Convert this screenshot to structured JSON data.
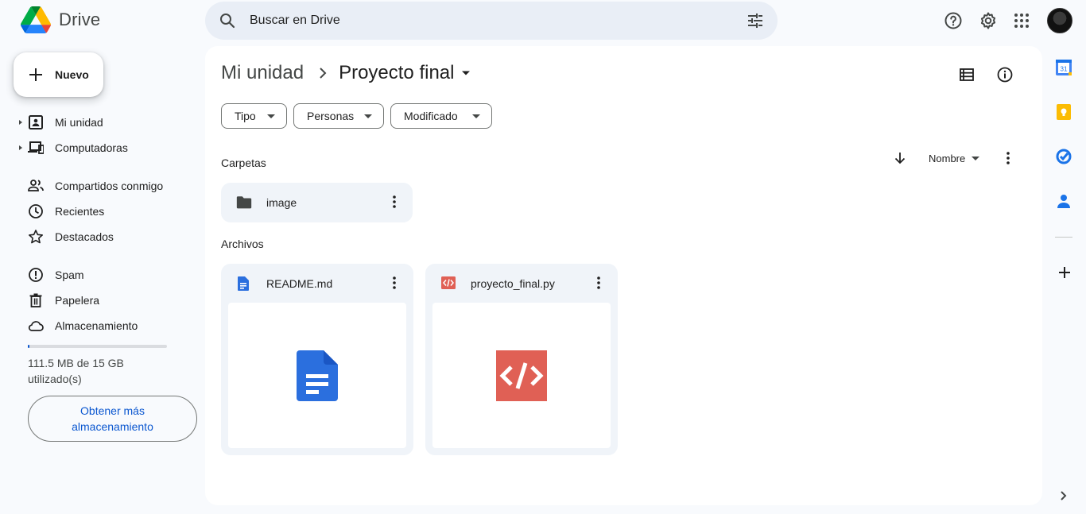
{
  "app": {
    "name": "Drive",
    "colors": {
      "accent": "#0b57d0",
      "search_bg": "#e9eef6",
      "card_bg": "#f0f4f9",
      "doc_blue": "#2b6fde",
      "code_red": "#e06055"
    }
  },
  "search": {
    "placeholder": "Buscar en Drive",
    "icon": "search-icon",
    "filter_icon": "tune-icon"
  },
  "header_icons": [
    "help-icon",
    "settings-icon",
    "apps-grid-icon",
    "avatar"
  ],
  "sidebar": {
    "new_button": "Nuevo",
    "items": [
      {
        "label": "Mi unidad",
        "icon": "my-drive-icon",
        "expandable": true
      },
      {
        "label": "Computadoras",
        "icon": "computers-icon",
        "expandable": true
      },
      {
        "label": "Compartidos conmigo",
        "icon": "shared-icon",
        "expandable": false
      },
      {
        "label": "Recientes",
        "icon": "clock-icon",
        "expandable": false
      },
      {
        "label": "Destacados",
        "icon": "star-icon",
        "expandable": false
      },
      {
        "label": "Spam",
        "icon": "spam-icon",
        "expandable": false
      },
      {
        "label": "Papelera",
        "icon": "trash-icon",
        "expandable": false
      },
      {
        "label": "Almacenamiento",
        "icon": "cloud-icon",
        "expandable": false
      }
    ],
    "storage": {
      "used_text": "111.5 MB de 15 GB utilizado(s)",
      "used_fraction": 0.0073,
      "more_button": "Obtener más almacenamiento"
    }
  },
  "main": {
    "breadcrumb": {
      "root": "Mi unidad",
      "current": "Proyecto final"
    },
    "filters": [
      "Tipo",
      "Personas",
      "Modificado"
    ],
    "sort": {
      "label": "Nombre",
      "direction": "descending"
    },
    "folders_title": "Carpetas",
    "folders": [
      {
        "name": "image"
      }
    ],
    "files_title": "Archivos",
    "files": [
      {
        "name": "README.md",
        "type": "document"
      },
      {
        "name": "proyecto_final.py",
        "type": "code"
      }
    ]
  },
  "side_panel": [
    "calendar-icon",
    "keep-icon",
    "tasks-icon",
    "contacts-icon",
    "add-addon-icon",
    "expand-panel-icon"
  ]
}
